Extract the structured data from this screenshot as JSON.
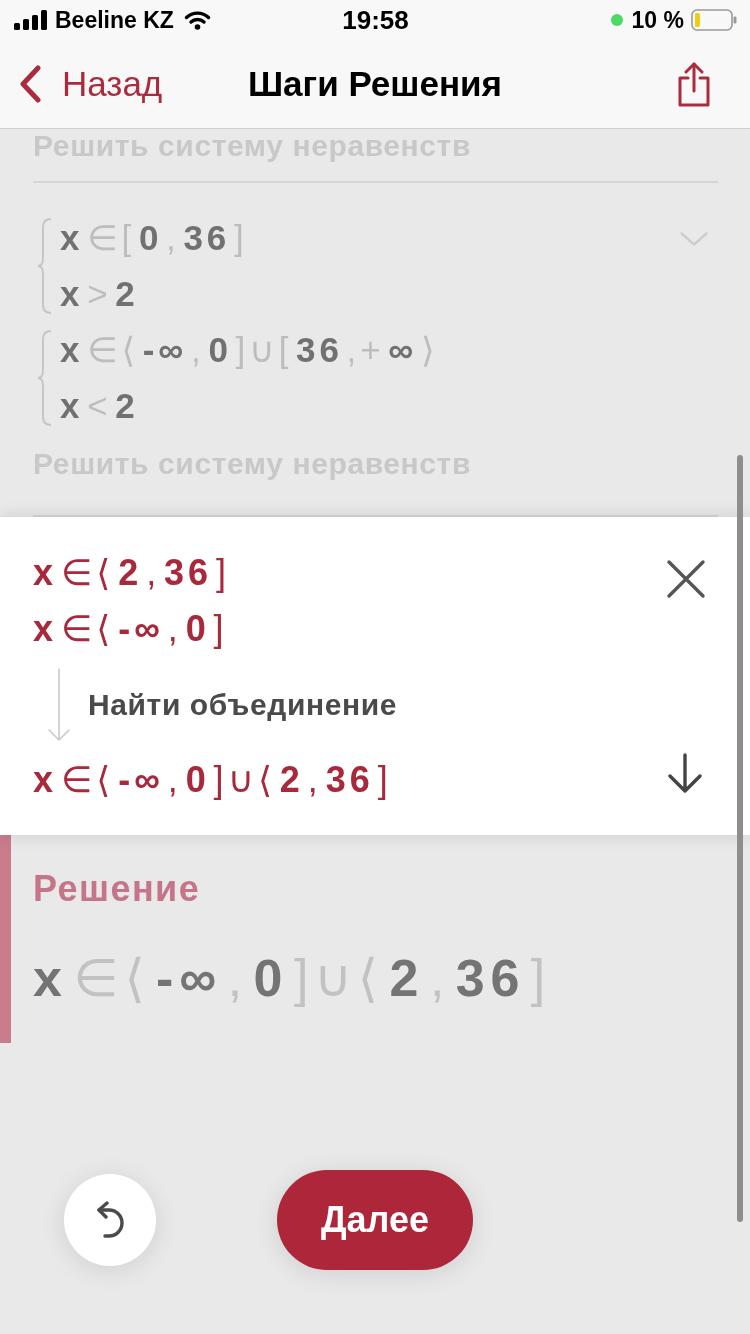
{
  "status_bar": {
    "carrier": "Beeline KZ",
    "time": "19:58",
    "battery": "10 %"
  },
  "nav_bar": {
    "back": "Назад",
    "title": "Шаги Решения"
  },
  "previous_step": {
    "caption": "Решить систему неравенств"
  },
  "collapsed_step": {
    "expanded": false,
    "systems": [
      [
        "x∈[0,36]",
        "x>2"
      ],
      [
        "x∈⟨-∞,0]∪[36,+∞⟩",
        "x<2"
      ]
    ],
    "caption": "Решить систему неравенств"
  },
  "current_step": {
    "inputs": [
      "x∈⟨2,36]",
      "x∈⟨-∞,0]"
    ],
    "action": "Найти объединение",
    "result": "x∈⟨-∞,0]∪⟨2,36]"
  },
  "solution": {
    "label": "Решение",
    "value": "x∈⟨-∞,0]∪⟨2,36]"
  },
  "buttons": {
    "next": "Далее"
  }
}
